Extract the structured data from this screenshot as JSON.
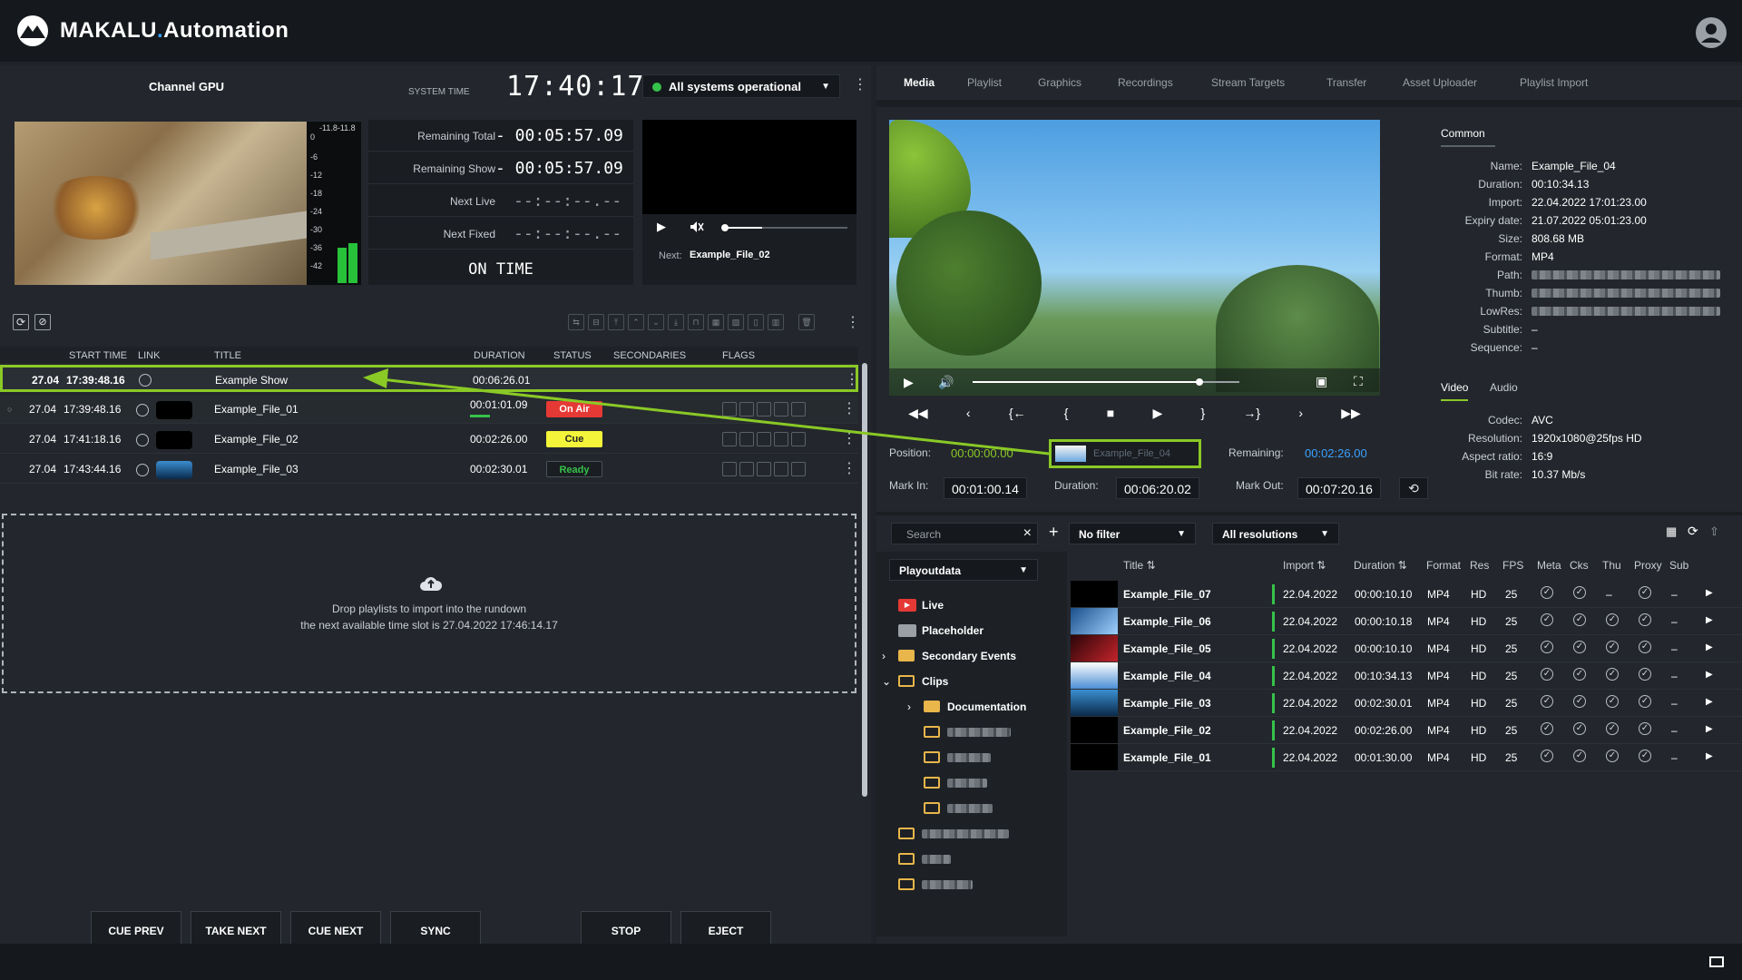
{
  "app": {
    "brand_main": "MAKALU",
    "brand_dot": ".",
    "brand_suffix": "Automation"
  },
  "channel": {
    "name": "Channel GPU",
    "system_time_label": "SYSTEM TIME",
    "system_time": "17:40:17",
    "status": "All systems operational"
  },
  "vu": {
    "scale": [
      "0",
      "-6",
      "-12",
      "-18",
      "-24",
      "-30",
      "-36",
      "-42"
    ],
    "peak": "-11.8-11.8",
    "levels": [
      0.22,
      0.25
    ]
  },
  "timers": {
    "remaining_total_label": "Remaining Total",
    "remaining_total": "-  00:05:57.09",
    "remaining_show_label": "Remaining Show",
    "remaining_show": "-  00:05:57.09",
    "next_live_label": "Next Live",
    "next_live": "--:--:--.--",
    "next_fixed_label": "Next Fixed",
    "next_fixed": "--:--:--.--",
    "on_time": "ON TIME"
  },
  "mini_player": {
    "next_label": "Next:",
    "next_value": "Example_File_02"
  },
  "rundown": {
    "headers": {
      "start": "START TIME",
      "link": "LINK",
      "title": "TITLE",
      "duration": "DURATION",
      "status": "STATUS",
      "secondaries": "SECONDARIES",
      "flags": "FLAGS"
    },
    "rows": [
      {
        "date": "27.04",
        "time": "17:39:48.16",
        "title": "Example Show",
        "duration": "00:06:26.01",
        "status": ""
      },
      {
        "date": "27.04",
        "time": "17:39:48.16",
        "title": "Example_File_01",
        "duration": "00:01:01.09",
        "status": "On Air"
      },
      {
        "date": "27.04",
        "time": "17:41:18.16",
        "title": "Example_File_02",
        "duration": "00:02:26.00",
        "status": "Cue"
      },
      {
        "date": "27.04",
        "time": "17:43:44.16",
        "title": "Example_File_03",
        "duration": "00:02:30.01",
        "status": "Ready"
      }
    ],
    "drop_line1": "Drop playlists to import into the rundown",
    "drop_line2": "the next available time slot is 27.04.2022 17:46:14.17"
  },
  "controls": {
    "cue_prev": "CUE PREV",
    "take_next": "TAKE NEXT",
    "cue_next": "CUE NEXT",
    "sync": "SYNC",
    "stop": "STOP",
    "eject": "EJECT"
  },
  "tabs": [
    "Media",
    "Playlist",
    "Graphics",
    "Recordings",
    "Stream Targets",
    "Transfer",
    "Asset Uploader",
    "Playlist Import"
  ],
  "media_player": {
    "position_label": "Position:",
    "position": "00:00:00.00",
    "drag_item": "Example_File_04",
    "remaining_label": "Remaining:",
    "remaining": "00:02:26.00",
    "mark_in_label": "Mark In:",
    "mark_in": "00:01:00.14",
    "duration_label": "Duration:",
    "duration": "00:06:20.02",
    "mark_out_label": "Mark Out:",
    "mark_out": "00:07:20.16"
  },
  "info": {
    "tab_common": "Common",
    "tab_video": "Video",
    "tab_audio": "Audio",
    "common": [
      [
        "Name:",
        "Example_File_04"
      ],
      [
        "Duration:",
        "00:10:34.13"
      ],
      [
        "Import:",
        "22.04.2022 17:01:23.00"
      ],
      [
        "Expiry date:",
        "21.07.2022 05:01:23.00"
      ],
      [
        "Size:",
        "808.68 MB"
      ],
      [
        "Format:",
        "MP4"
      ],
      [
        "Path:",
        ""
      ],
      [
        "Thumb:",
        ""
      ],
      [
        "LowRes:",
        ""
      ],
      [
        "Subtitle:",
        "–"
      ],
      [
        "Sequence:",
        "–"
      ]
    ],
    "video": [
      [
        "Codec:",
        "AVC"
      ],
      [
        "Resolution:",
        "1920x1080@25fps  HD"
      ],
      [
        "Aspect ratio:",
        "16:9"
      ],
      [
        "Bit rate:",
        "10.37 Mb/s"
      ]
    ]
  },
  "browser": {
    "search_placeholder": "Search",
    "filter": "No filter",
    "resolution": "All resolutions",
    "source": "Playoutdata",
    "tree": {
      "live": "Live",
      "placeholder": "Placeholder",
      "secondary": "Secondary Events",
      "clips": "Clips",
      "documentation": "Documentation"
    },
    "headers": {
      "title": "Title",
      "import": "Import",
      "duration": "Duration",
      "format": "Format",
      "res": "Res",
      "fps": "FPS",
      "meta": "Meta",
      "cks": "Cks",
      "thu": "Thu",
      "proxy": "Proxy",
      "sub": "Sub"
    },
    "rows": [
      {
        "title": "Example_File_07",
        "import": "22.04.2022",
        "duration": "00:00:10.10",
        "format": "MP4",
        "res": "HD",
        "fps": "25",
        "thu": "–",
        "sub": "–"
      },
      {
        "title": "Example_File_06",
        "import": "22.04.2022",
        "duration": "00:00:10.18",
        "format": "MP4",
        "res": "HD",
        "fps": "25",
        "thu": "✓",
        "sub": "–"
      },
      {
        "title": "Example_File_05",
        "import": "22.04.2022",
        "duration": "00:00:10.10",
        "format": "MP4",
        "res": "HD",
        "fps": "25",
        "thu": "✓",
        "sub": "–"
      },
      {
        "title": "Example_File_04",
        "import": "22.04.2022",
        "duration": "00:10:34.13",
        "format": "MP4",
        "res": "HD",
        "fps": "25",
        "thu": "✓",
        "sub": "–"
      },
      {
        "title": "Example_File_03",
        "import": "22.04.2022",
        "duration": "00:02:30.01",
        "format": "MP4",
        "res": "HD",
        "fps": "25",
        "thu": "✓",
        "sub": "–"
      },
      {
        "title": "Example_File_02",
        "import": "22.04.2022",
        "duration": "00:02:26.00",
        "format": "MP4",
        "res": "HD",
        "fps": "25",
        "thu": "✓",
        "sub": "–"
      },
      {
        "title": "Example_File_01",
        "import": "22.04.2022",
        "duration": "00:01:30.00",
        "format": "MP4",
        "res": "HD",
        "fps": "25",
        "thu": "✓",
        "sub": "–"
      }
    ]
  },
  "colors": {
    "accent_green": "#8ac926",
    "on_air": "#e53935",
    "cue": "#f4f43a",
    "ready_text": "#35c24a",
    "blue_value": "#3aa0ff"
  }
}
